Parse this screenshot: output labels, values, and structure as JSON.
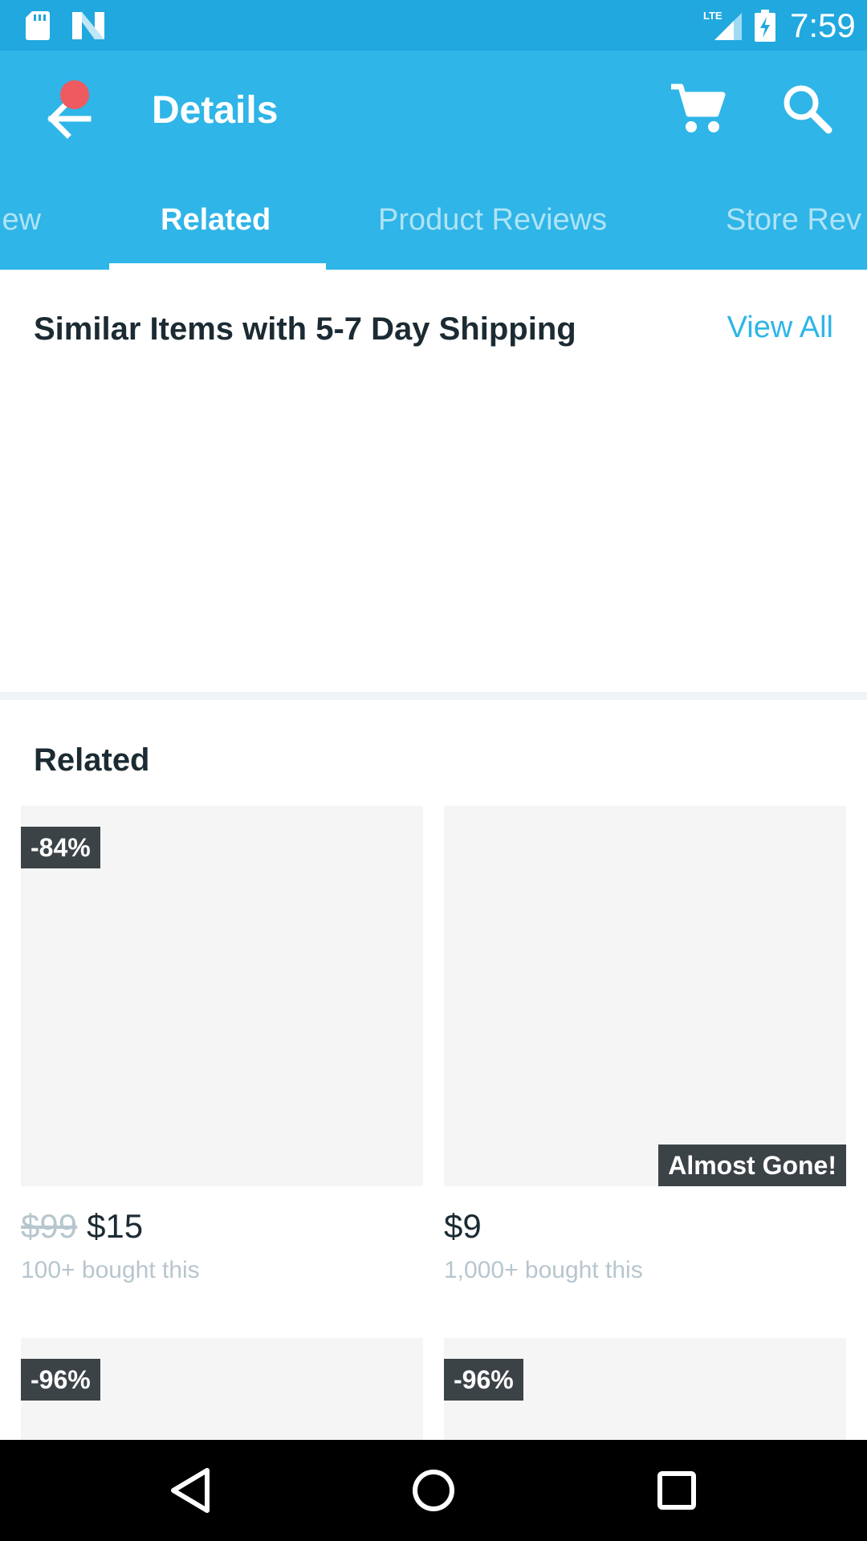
{
  "status_bar": {
    "time": "7:59",
    "network": "LTE"
  },
  "header": {
    "title": "Details"
  },
  "tabs": [
    {
      "label": "iew"
    },
    {
      "label": "Related"
    },
    {
      "label": "Product Reviews"
    },
    {
      "label": "Store Rev"
    }
  ],
  "similar": {
    "title": "Similar Items with 5-7 Day Shipping",
    "view_all": "View All"
  },
  "related": {
    "title": "Related",
    "items": [
      {
        "badge": "-84%",
        "old_price": "$99",
        "price": "$15",
        "bought": "100+ bought this"
      },
      {
        "badge": "Almost Gone!",
        "old_price": "",
        "price": "$9",
        "bought": "1,000+ bought this"
      },
      {
        "badge": "-96%"
      },
      {
        "badge": "-96%"
      }
    ]
  },
  "colors": {
    "status_bar": "#21a8df",
    "app_bar": "#2fb5e7",
    "link": "#2fb5e7",
    "badge": "#3c4347",
    "notification": "#ee5a5f"
  },
  "icons": [
    "sd-card-icon",
    "n-logo-icon",
    "lte-signal-icon",
    "battery-icon",
    "back-arrow-icon",
    "cart-icon",
    "search-icon",
    "nav-back-icon",
    "nav-home-icon",
    "nav-recents-icon"
  ]
}
